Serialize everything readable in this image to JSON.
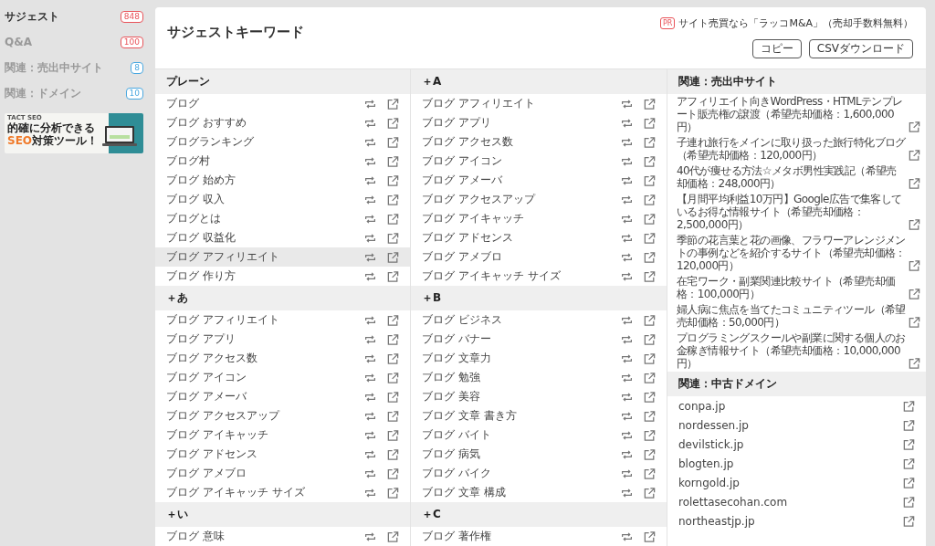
{
  "sidebar": {
    "items": [
      {
        "label": "サジェスト",
        "count": "848",
        "selected": true,
        "color": "#e8545a"
      },
      {
        "label": "Q&A",
        "count": "100",
        "selected": false,
        "color": "#e8545a"
      },
      {
        "label": "関連：売出中サイト",
        "count": "8",
        "selected": false,
        "color": "#4aa8e0"
      },
      {
        "label": "関連：ドメイン",
        "count": "10",
        "selected": false,
        "color": "#4aa8e0"
      }
    ],
    "banner": {
      "brand": "TACT SEO",
      "line1": "的確に分析できる",
      "line2_accent": "SEO",
      "line2": "対策ツール！"
    }
  },
  "header": {
    "title": "サジェストキーワード",
    "pr_badge": "PR",
    "pr_text": "サイト売買なら「ラッコM&A」（売却手数料無料）",
    "buttons": [
      "コピー",
      "CSVダウンロード"
    ]
  },
  "columns": [
    {
      "groups": [
        {
          "title": "プレーン",
          "rows": [
            {
              "text": "ブログ",
              "hovered": false
            },
            {
              "text": "ブログ おすすめ",
              "hovered": false
            },
            {
              "text": "ブログランキング",
              "hovered": false
            },
            {
              "text": "ブログ村",
              "hovered": false
            },
            {
              "text": "ブログ 始め方",
              "hovered": false
            },
            {
              "text": "ブログ 収入",
              "hovered": false
            },
            {
              "text": "ブログとは",
              "hovered": false
            },
            {
              "text": "ブログ 収益化",
              "hovered": false
            },
            {
              "text": "ブログ アフィリエイト",
              "hovered": true
            },
            {
              "text": "ブログ 作り方",
              "hovered": false
            }
          ]
        },
        {
          "title": "＋あ",
          "rows": [
            {
              "text": "ブログ アフィリエイト",
              "hovered": false
            },
            {
              "text": "ブログ アプリ",
              "hovered": false
            },
            {
              "text": "ブログ アクセス数",
              "hovered": false
            },
            {
              "text": "ブログ アイコン",
              "hovered": false
            },
            {
              "text": "ブログ アメーバ",
              "hovered": false
            },
            {
              "text": "ブログ アクセスアップ",
              "hovered": false
            },
            {
              "text": "ブログ アイキャッチ",
              "hovered": false
            },
            {
              "text": "ブログ アドセンス",
              "hovered": false
            },
            {
              "text": "ブログ アメブロ",
              "hovered": false
            },
            {
              "text": "ブログ アイキャッチ サイズ",
              "hovered": false
            }
          ]
        },
        {
          "title": "＋い",
          "rows": [
            {
              "text": "ブログ 意味",
              "hovered": false
            }
          ]
        }
      ]
    },
    {
      "groups": [
        {
          "title": "＋A",
          "rows": [
            {
              "text": "ブログ アフィリエイト",
              "hovered": false
            },
            {
              "text": "ブログ アプリ",
              "hovered": false
            },
            {
              "text": "ブログ アクセス数",
              "hovered": false
            },
            {
              "text": "ブログ アイコン",
              "hovered": false
            },
            {
              "text": "ブログ アメーバ",
              "hovered": false
            },
            {
              "text": "ブログ アクセスアップ",
              "hovered": false
            },
            {
              "text": "ブログ アイキャッチ",
              "hovered": false
            },
            {
              "text": "ブログ アドセンス",
              "hovered": false
            },
            {
              "text": "ブログ アメブロ",
              "hovered": false
            },
            {
              "text": "ブログ アイキャッチ サイズ",
              "hovered": false
            }
          ]
        },
        {
          "title": "＋B",
          "rows": [
            {
              "text": "ブログ ビジネス",
              "hovered": false
            },
            {
              "text": "ブログ バナー",
              "hovered": false
            },
            {
              "text": "ブログ 文章力",
              "hovered": false
            },
            {
              "text": "ブログ 勉強",
              "hovered": false
            },
            {
              "text": "ブログ 美容",
              "hovered": false
            },
            {
              "text": "ブログ 文章 書き方",
              "hovered": false
            },
            {
              "text": "ブログ バイト",
              "hovered": false
            },
            {
              "text": "ブログ 病気",
              "hovered": false
            },
            {
              "text": "ブログ バイク",
              "hovered": false
            },
            {
              "text": "ブログ 文章 構成",
              "hovered": false
            }
          ]
        },
        {
          "title": "＋C",
          "rows": [
            {
              "text": "ブログ 著作権",
              "hovered": false
            }
          ]
        }
      ]
    }
  ],
  "related_sites": {
    "title": "関連：売出中サイト",
    "items": [
      "アフィリエイト向きWordPress・HTMLテンプレート販売権の譲渡（希望売却価格：1,600,000円）",
      "子連れ旅行をメインに取り扱った旅行特化ブログ（希望売却価格：120,000円）",
      "40代が痩せる方法☆メタボ男性実践記（希望売却価格：248,000円）",
      "【月間平均利益10万円】Google広告で集客しているお得な情報サイト（希望売却価格：2,500,000円）",
      "季節の花言葉と花の画像、フラワーアレンジメントの事例などを紹介するサイト（希望売却価格：120,000円）",
      "在宅ワーク・副業関連比較サイト（希望売却価格：100,000円）",
      "婦人病に焦点を当てたコミュニティツール（希望売却価格：50,000円）",
      "プログラミングスクールや副業に関する個人のお金稼ぎ情報サイト（希望売却価格：10,000,000円）"
    ]
  },
  "related_domains": {
    "title": "関連：中古ドメイン",
    "items": [
      "conpa.jp",
      "nordessen.jp",
      "devilstick.jp",
      "blogten.jp",
      "korngold.jp",
      "rolettasecohan.com",
      "northeastjp.jp"
    ]
  }
}
